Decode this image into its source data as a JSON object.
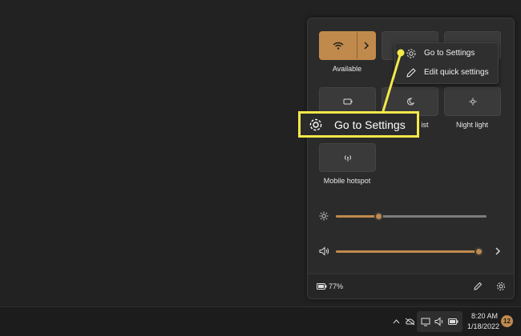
{
  "colors": {
    "accent": "#c08a4c",
    "callout": "#f3e94a",
    "panel": "#2b2b2b",
    "taskbar": "#1c1c1c"
  },
  "quick_settings": {
    "tiles": [
      {
        "label": "Available",
        "icon": "wifi-icon"
      },
      {
        "label": "",
        "icon": "bluetooth-icon"
      },
      {
        "label": "",
        "icon": "airplane-icon"
      },
      {
        "label": "",
        "icon": "battery-saver-icon"
      },
      {
        "label": "ist",
        "icon": "focus-assist-icon"
      },
      {
        "label": "Night light",
        "icon": "night-light-icon"
      },
      {
        "label": "Mobile hotspot",
        "icon": "mobile-hotspot-icon"
      }
    ],
    "brightness": {
      "icon": "brightness-icon",
      "level_percent": 28
    },
    "volume": {
      "icon": "speaker-icon",
      "level_percent": 97
    },
    "battery_text": "77%"
  },
  "context_menu": {
    "items": [
      {
        "label": "Go to Settings",
        "icon": "gear-icon"
      },
      {
        "label": "Edit quick settings",
        "icon": "pencil-icon"
      }
    ]
  },
  "callout": {
    "label": "Go to Settings",
    "icon": "gear-icon"
  },
  "taskbar": {
    "time": "8:20 AM",
    "date": "1/18/2022",
    "notification_count": "12"
  }
}
